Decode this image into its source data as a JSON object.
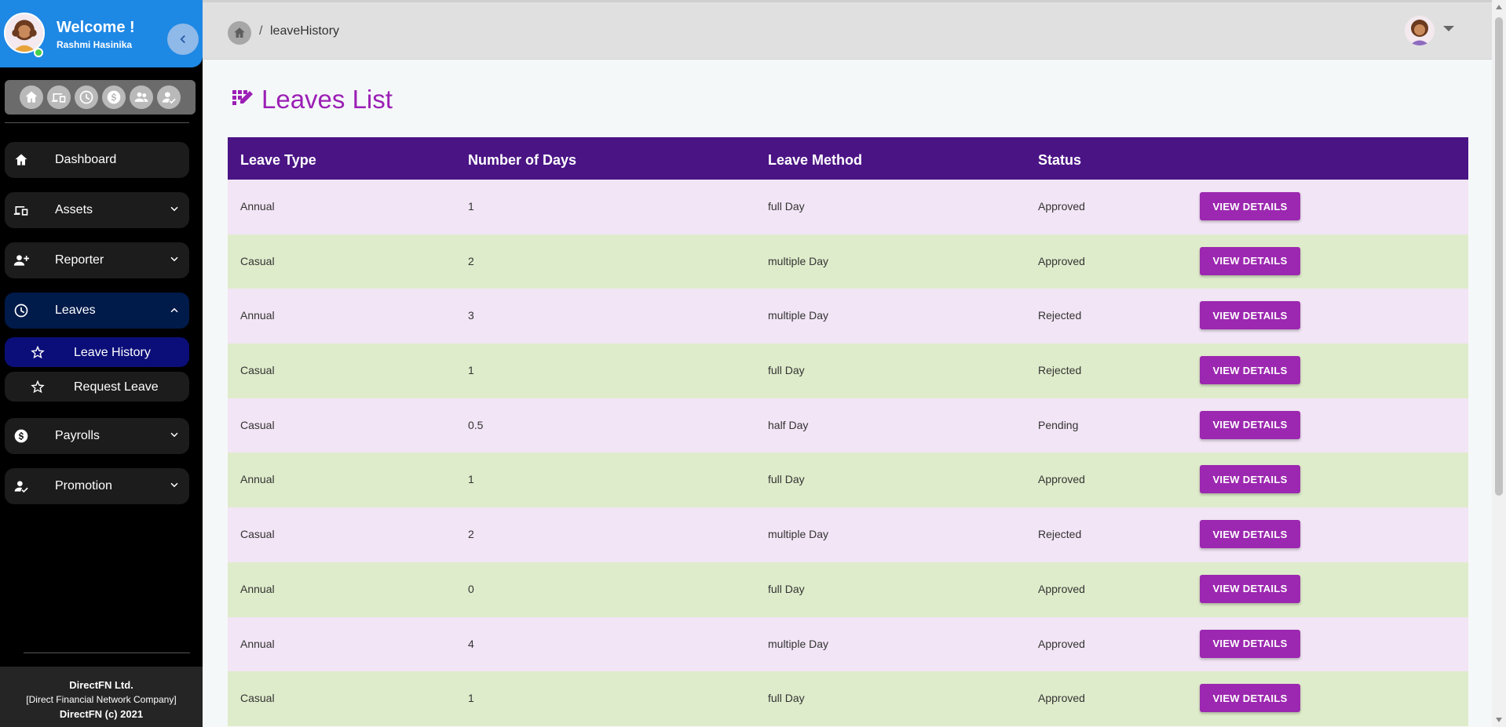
{
  "sidebar": {
    "welcome": "Welcome !",
    "username": "Rashmi Hasinika",
    "quick_icons": [
      "home-icon",
      "devices-icon",
      "clock-icon",
      "dollar-icon",
      "people-icon",
      "person-check-icon"
    ],
    "nav": {
      "dashboard": "Dashboard",
      "assets": "Assets",
      "reporter": "Reporter",
      "leaves": "Leaves",
      "leave_history": "Leave History",
      "request_leave": "Request Leave",
      "payrolls": "Payrolls",
      "promotion": "Promotion"
    },
    "footer": {
      "line1": "DirectFN Ltd.",
      "line2": "[Direct Financial Network Company]",
      "line3": "DirectFN (c) 2021"
    }
  },
  "header": {
    "breadcrumb_sep": "/",
    "breadcrumb_page": "leaveHistory"
  },
  "main": {
    "title": "Leaves List",
    "columns": [
      "Leave Type",
      "Number of Days",
      "Leave Method",
      "Status"
    ],
    "button_label": "VIEW DETAILS",
    "rows": [
      [
        "Annual",
        "1",
        "full Day",
        "Approved"
      ],
      [
        "Casual",
        "2",
        "multiple Day",
        "Approved"
      ],
      [
        "Annual",
        "3",
        "multiple Day",
        "Rejected"
      ],
      [
        "Casual",
        "1",
        "full Day",
        "Rejected"
      ],
      [
        "Casual",
        "0.5",
        "half Day",
        "Pending"
      ],
      [
        "Annual",
        "1",
        "full Day",
        "Approved"
      ],
      [
        "Casual",
        "2",
        "multiple Day",
        "Rejected"
      ],
      [
        "Annual",
        "0",
        "full Day",
        "Approved"
      ],
      [
        "Annual",
        "4",
        "multiple Day",
        "Approved"
      ],
      [
        "Casual",
        "1",
        "full Day",
        "Approved"
      ]
    ]
  },
  "colors": {
    "accent": "#9c27b0",
    "table_header": "#4a1485",
    "row_odd": "#f2e5f5",
    "row_even": "#dfeccb",
    "profile_bg": "#1e88e5"
  }
}
